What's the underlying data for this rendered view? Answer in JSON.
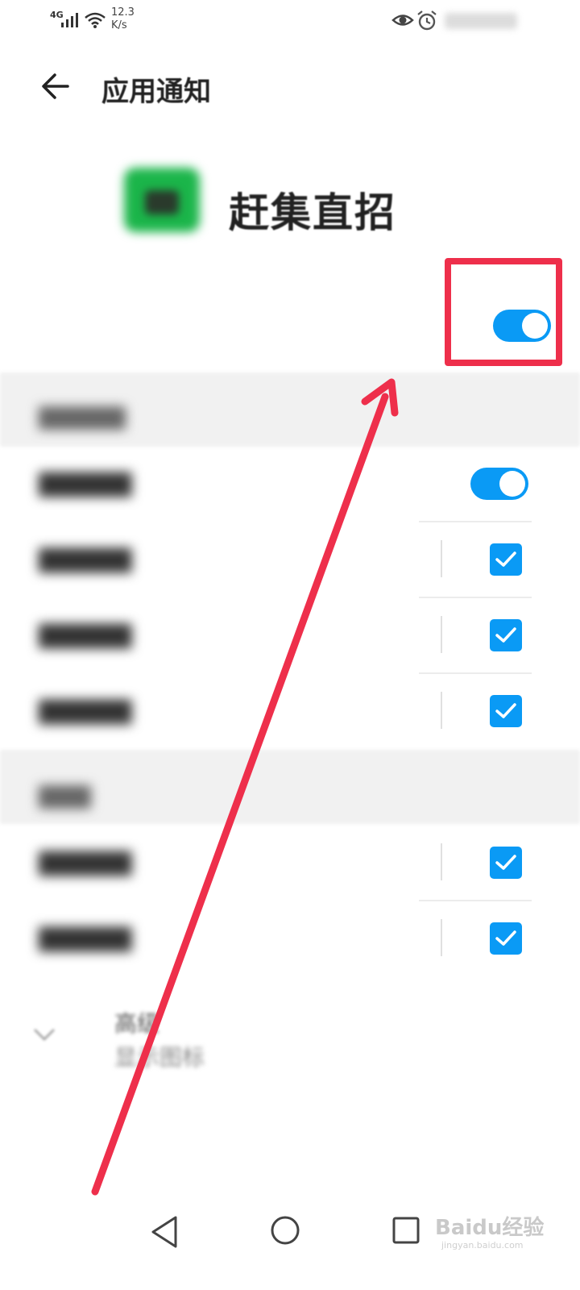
{
  "status_bar": {
    "network_type": "4G",
    "speed_value": "12.3",
    "speed_unit": "K/s",
    "icons": [
      "signal-icon",
      "wifi-icon",
      "eye-icon",
      "alarm-icon",
      "battery-icon"
    ]
  },
  "header": {
    "title": "应用通知",
    "back_icon": "arrow-left-icon"
  },
  "app": {
    "name": "赶集直招",
    "icon": "app-icon",
    "icon_color": "#1bb54a",
    "main_toggle_on": true
  },
  "sections": [
    {
      "label": "",
      "rows": [
        {
          "label": "",
          "control": "toggle",
          "on": true
        },
        {
          "label": "",
          "control": "checkbox",
          "checked": true
        },
        {
          "label": "",
          "control": "checkbox",
          "checked": true
        },
        {
          "label": "",
          "control": "checkbox",
          "checked": true
        }
      ]
    },
    {
      "label": "",
      "rows": [
        {
          "label": "",
          "control": "checkbox",
          "checked": true
        },
        {
          "label": "",
          "control": "checkbox",
          "checked": true
        }
      ]
    }
  ],
  "advanced": {
    "title": "高级",
    "subtitle": "显示图标",
    "chevron_icon": "chevron-down-icon"
  },
  "annotation": {
    "color": "#ee2f4b"
  },
  "nav_bar": {
    "icons": [
      "nav-back-icon",
      "nav-home-icon",
      "nav-recent-icon"
    ]
  },
  "watermark": {
    "text": "Baidu经验",
    "sub": "jingyan.baidu.com"
  },
  "colors": {
    "accent": "#0a9af5",
    "section_bg": "#f1f1f1"
  }
}
